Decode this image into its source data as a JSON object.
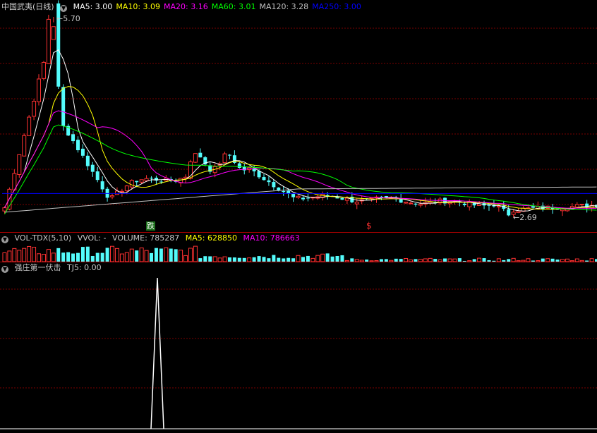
{
  "main": {
    "stock_name": "中国武夷(日线)",
    "ma": [
      {
        "label": "MA5: 3.00",
        "color": "#ffffff"
      },
      {
        "label": "MA10: 3.09",
        "color": "#ffff00"
      },
      {
        "label": "MA20: 3.16",
        "color": "#ff00ff"
      },
      {
        "label": "MA60: 3.01",
        "color": "#00ff00"
      },
      {
        "label": "MA120: 3.28",
        "color": "#c0c0c0"
      },
      {
        "label": "MA250: 3.00",
        "color": "#0000ff"
      }
    ],
    "high_label": "5.70",
    "low_label": "2.69",
    "marker_green": "跌",
    "marker_red": "$"
  },
  "volume": {
    "title": "VOL-TDX(5,10)",
    "vvol": "VVOL: -",
    "volume": "VOLUME: 785287",
    "ma5": "MA5: 628850",
    "ma10": "MA10: 786663"
  },
  "indicator": {
    "title": "强庄第一伏击",
    "tj5": "TJ5: 0.00"
  },
  "colors": {
    "up": "#ff3232",
    "down": "#54fcfc",
    "grid": "#7a0000",
    "ma5": "#ffffff",
    "ma10": "#ffff00",
    "ma20": "#ff00ff",
    "ma60": "#00ff00",
    "ma120": "#c0c0c0",
    "ma250": "#0000ff"
  }
}
